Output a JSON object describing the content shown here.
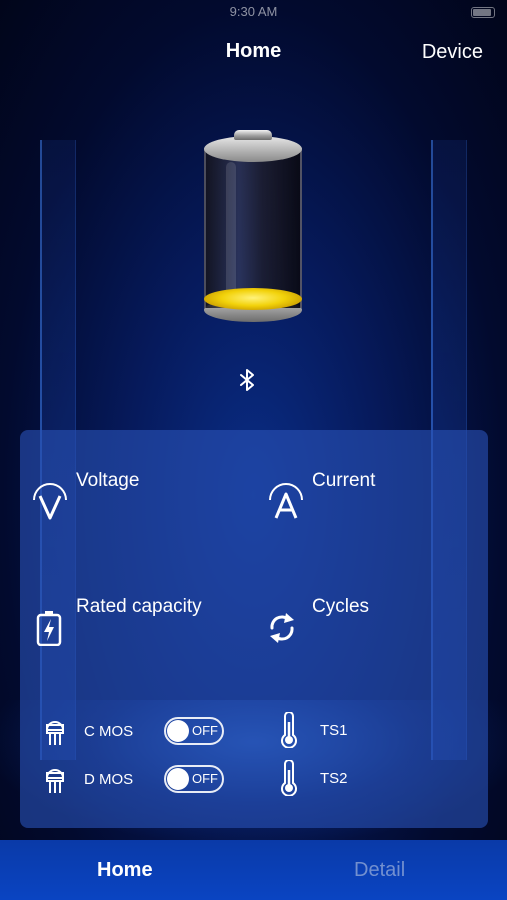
{
  "status_bar": {
    "time": "9:30 AM"
  },
  "nav": {
    "title": "Home",
    "device_label": "Device"
  },
  "battery": {
    "icon": "battery-icon",
    "fill_color": "#f2d20a",
    "charge_level": 0.05
  },
  "bluetooth": {
    "icon": "bluetooth-icon"
  },
  "panel": {
    "voltage": {
      "label": "Voltage",
      "value": "",
      "icon": "voltage-icon"
    },
    "current": {
      "label": "Current",
      "value": "",
      "icon": "current-icon"
    },
    "rated_capacity": {
      "label": "Rated capacity",
      "value": "",
      "icon": "battery-charge-icon"
    },
    "cycles": {
      "label": "Cycles",
      "value": "",
      "icon": "cycles-icon"
    },
    "c_mos": {
      "label": "C MOS",
      "toggle_state": "OFF",
      "icon": "mosfet-icon"
    },
    "d_mos": {
      "label": "D MOS",
      "toggle_state": "OFF",
      "icon": "mosfet-icon"
    },
    "ts1": {
      "label": "TS1",
      "value": "",
      "icon": "thermometer-icon"
    },
    "ts2": {
      "label": "TS2",
      "value": "",
      "icon": "thermometer-icon"
    }
  },
  "tabbar": {
    "home_label": "Home",
    "detail_label": "Detail",
    "active_tab": "Home"
  },
  "colors": {
    "background": "#061a5c",
    "panel": "#2850b4",
    "tabbar": "#0a3aa8",
    "inactive_tab": "#c8d2e6"
  }
}
